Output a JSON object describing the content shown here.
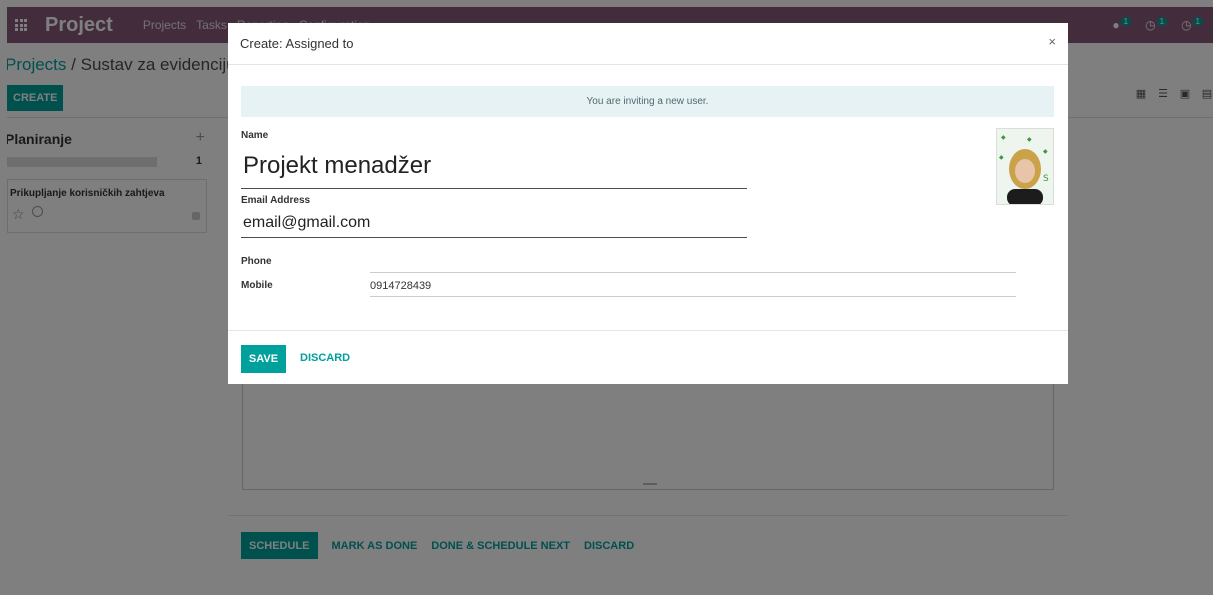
{
  "navbar": {
    "app_name": "Project",
    "menu": [
      "Projects",
      "Tasks",
      "Reporting",
      "Configuration"
    ],
    "systray": [
      {
        "icon": "chat-icon",
        "count": "1"
      },
      {
        "icon": "activity-icon",
        "count": "1"
      },
      {
        "icon": "clock-icon",
        "count": "1"
      }
    ]
  },
  "control_panel": {
    "breadcrumb_root": "Projects",
    "breadcrumb_separator": "/",
    "breadcrumb_current": "Sustav za evidenciju o",
    "create_label": "CREATE"
  },
  "kanban": {
    "column_title": "Planiranje",
    "column_count": "1",
    "card_title": "Prikupljanje korisničkih zahtjeva"
  },
  "back_dialog": {
    "buttons": [
      "SCHEDULE",
      "MARK AS DONE",
      "DONE & SCHEDULE NEXT",
      "DISCARD"
    ]
  },
  "modal": {
    "title": "Create: Assigned to",
    "close_symbol": "×",
    "alert": "You are inviting a new user.",
    "name_label": "Name",
    "name_value": "Projekt menadžer",
    "email_label": "Email Address",
    "email_value": "email@gmail.com",
    "phone_label": "Phone",
    "phone_value": "",
    "mobile_label": "Mobile",
    "mobile_value": "0914728439",
    "save_label": "SAVE",
    "discard_label": "DISCARD"
  },
  "colors": {
    "brand": "#875a7b",
    "accent": "#00a09d"
  }
}
